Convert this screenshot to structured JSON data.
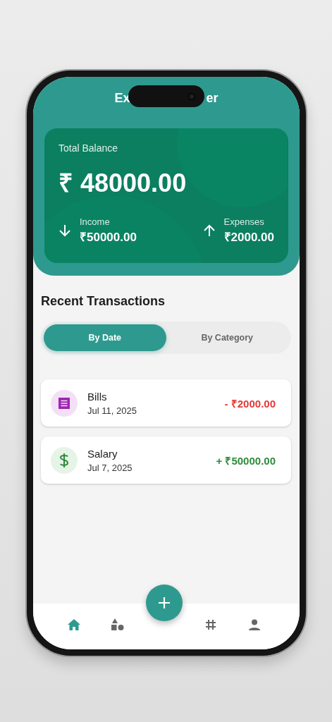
{
  "header": {
    "title_left": "Ex",
    "title_right": "er"
  },
  "balance": {
    "label": "Total Balance",
    "amount": "₹ 48000.00"
  },
  "summary": [
    {
      "kind": "income",
      "label": "Income",
      "amount": "₹50000.00"
    },
    {
      "kind": "expense",
      "label": "Expenses",
      "amount": "₹2000.00"
    }
  ],
  "section_title": "Recent Transactions",
  "tabs": [
    {
      "label": "By Date",
      "selected": true
    },
    {
      "label": "By Category",
      "selected": false
    }
  ],
  "transactions": [
    {
      "kind": "bill",
      "name": "Bills",
      "date": "Jul 11, 2025",
      "amount": "- ₹2000.00",
      "color": "#e53935"
    },
    {
      "kind": "salary",
      "name": "Salary",
      "date": "Jul 7, 2025",
      "amount": "+ ₹50000.00",
      "color": "#2e8b3a"
    }
  ],
  "nav": [
    {
      "kind": "home",
      "selected": true
    },
    {
      "kind": "shapes",
      "selected": false
    },
    {
      "kind": "hash",
      "selected": false
    },
    {
      "kind": "person",
      "selected": false
    }
  ]
}
